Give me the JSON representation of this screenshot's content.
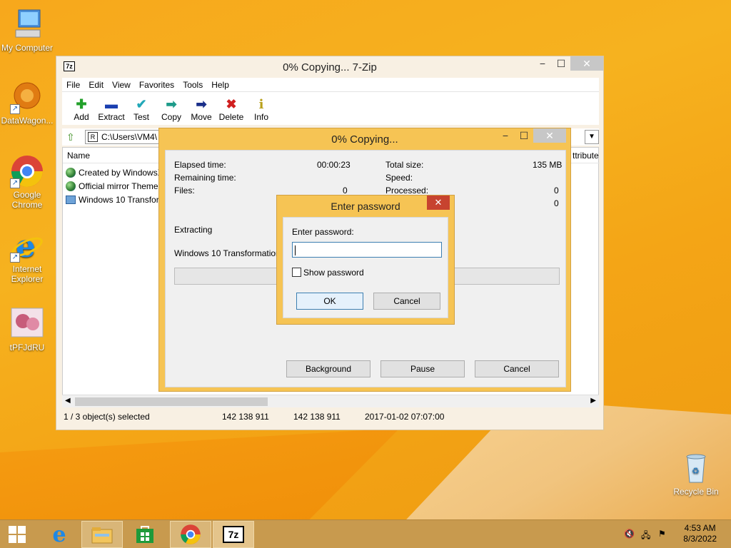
{
  "desktop": {
    "icons": [
      {
        "label": "My Computer"
      },
      {
        "label": "DataWagon..."
      },
      {
        "label": "Google Chrome"
      },
      {
        "label": "Internet Explorer"
      },
      {
        "label": "tPFJdRU"
      },
      {
        "label": "Recycle Bin"
      }
    ]
  },
  "main_window": {
    "title": "0% Copying... 7-Zip",
    "app_icon": "7z",
    "menu": [
      "File",
      "Edit",
      "View",
      "Favorites",
      "Tools",
      "Help"
    ],
    "toolbar": [
      {
        "label": "Add",
        "icon": "plus-icon",
        "color": "#22a02a"
      },
      {
        "label": "Extract",
        "icon": "minus-icon",
        "color": "#1a3fb0"
      },
      {
        "label": "Test",
        "icon": "check-icon",
        "color": "#22a8b8"
      },
      {
        "label": "Copy",
        "icon": "arrow-right-icon",
        "color": "#1e9b8a"
      },
      {
        "label": "Move",
        "icon": "arrow-right-icon",
        "color": "#1a2f8a"
      },
      {
        "label": "Delete",
        "icon": "x-icon",
        "color": "#d01f1f"
      },
      {
        "label": "Info",
        "icon": "info-icon",
        "color": "#b8a01a"
      }
    ],
    "address": "C:\\Users\\VM4\\",
    "columns": {
      "name": "Name",
      "attributes": "ttribute"
    },
    "files": [
      {
        "name": "Created by WindowsX",
        "icon": "globe-icon"
      },
      {
        "name": "Official mirror Theme",
        "icon": "globe-icon"
      },
      {
        "name": "Windows 10 Transfor",
        "icon": "file-icon"
      }
    ],
    "status": {
      "selected": "1 / 3 object(s) selected",
      "size": "142 138 911",
      "packed": "142 138 911",
      "modified": "2017-01-02 07:07:00"
    }
  },
  "copy_dialog": {
    "title": "0% Copying...",
    "elapsed_label": "Elapsed time:",
    "elapsed_value": "00:00:23",
    "remaining_label": "Remaining time:",
    "files_label": "Files:",
    "files_value": "0",
    "total_size_label": "Total size:",
    "total_size_value": "135 MB",
    "speed_label": "Speed:",
    "processed_label": "Processed:",
    "processed_value": "0",
    "extra_value": "0",
    "action": "Extracting",
    "current_file": "Windows 10 Transformation Pa",
    "progress": 0,
    "buttons": {
      "background": "Background",
      "pause": "Pause",
      "cancel": "Cancel"
    }
  },
  "password_dialog": {
    "title": "Enter password",
    "prompt": "Enter password:",
    "value": "",
    "show_password": "Show password",
    "ok": "OK",
    "cancel": "Cancel"
  },
  "taskbar": {
    "time": "4:53 AM",
    "date": "8/3/2022"
  }
}
